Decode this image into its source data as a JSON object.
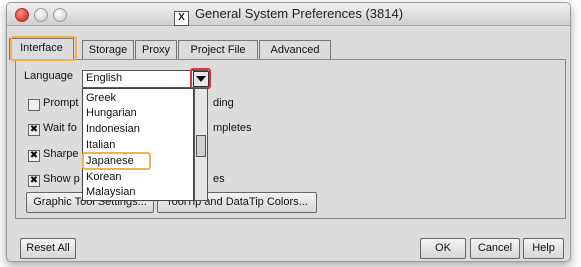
{
  "window": {
    "title": "General System Preferences (3814)",
    "x_icon_glyph": "X"
  },
  "tabs": [
    {
      "label": "Interface",
      "active": true
    },
    {
      "label": "Storage"
    },
    {
      "label": "Proxy"
    },
    {
      "label": "Project File"
    },
    {
      "label": "Advanced"
    }
  ],
  "language": {
    "label": "Language",
    "selected": "English"
  },
  "options": [
    {
      "label_visible_left": "Prompt",
      "label_visible_right": "ding",
      "checked": false
    },
    {
      "label_visible_left": "Wait fo",
      "label_visible_right": "mpletes",
      "checked": true
    },
    {
      "label_visible_left": "Sharpe",
      "label_visible_right": "",
      "checked": true
    },
    {
      "label_visible_left": "Show p",
      "label_visible_right": "es",
      "checked": true
    }
  ],
  "dropdown": {
    "items": [
      "Greek",
      "Hungarian",
      "Indonesian",
      "Italian",
      "Japanese",
      "Korean",
      "Malaysian"
    ],
    "highlighted": "Japanese"
  },
  "buttons": {
    "graphic_tool": "Graphic Tool Settings...",
    "tooltip_colors": "ToolTip and DataTip Colors...",
    "reset_all": "Reset All",
    "ok": "OK",
    "cancel": "Cancel",
    "help": "Help"
  },
  "colors": {
    "highlight_orange": "#f4b04a",
    "highlight_red": "#e03040"
  }
}
